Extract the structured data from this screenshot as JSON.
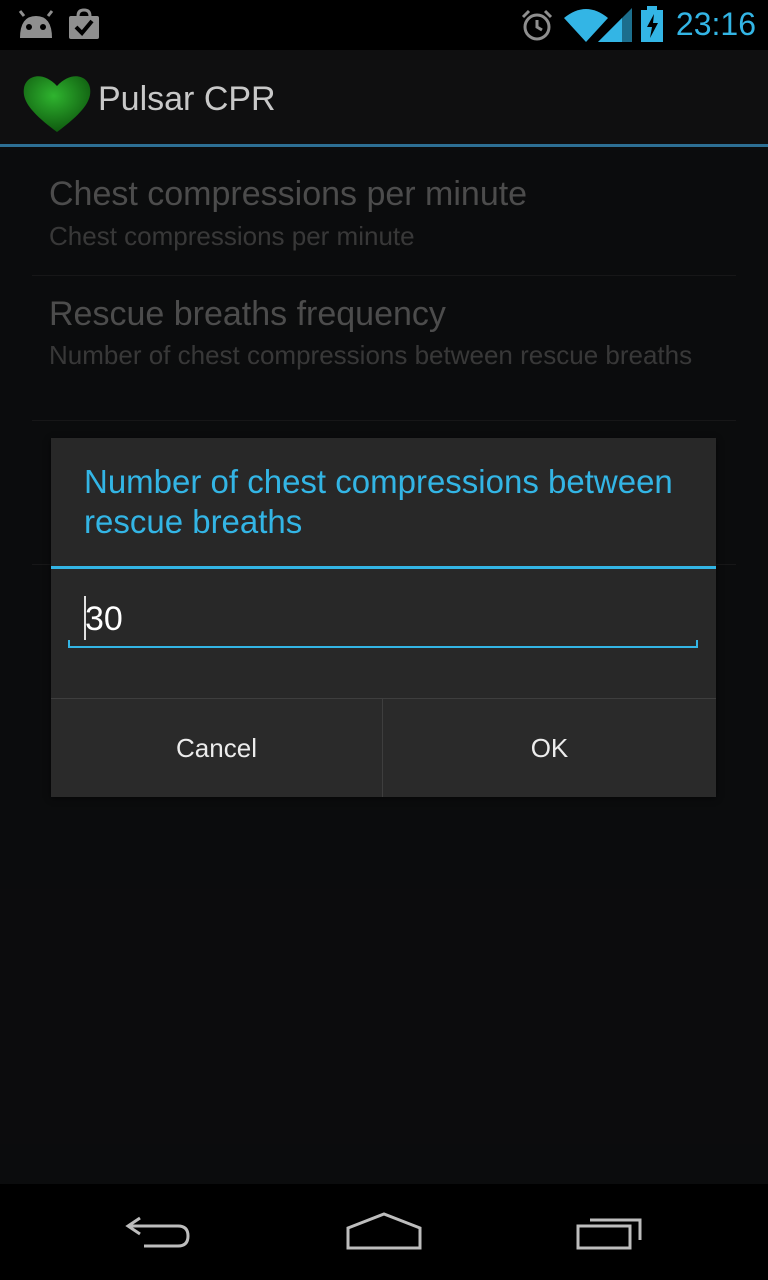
{
  "status_bar": {
    "time": "23:16",
    "icons": [
      "android-icon",
      "shopping-bag-check-icon",
      "alarm-icon",
      "wifi-icon",
      "signal-icon",
      "battery-charging-icon"
    ],
    "accent": "#33b5e5"
  },
  "action_bar": {
    "title": "Pulsar CPR",
    "logo": "heart-icon",
    "logo_color": "#1f8a1f"
  },
  "preferences": [
    {
      "title": "Chest compressions per minute",
      "summary": "Chest compressions per minute"
    },
    {
      "title": "Rescue breaths frequency",
      "summary": "Number of chest compressions between rescue breaths"
    }
  ],
  "dialog": {
    "title": "Number of chest compressions between rescue breaths",
    "input_value": "30",
    "cancel_label": "Cancel",
    "ok_label": "OK"
  },
  "nav_bar": {
    "buttons": [
      "back-icon",
      "home-icon",
      "recent-apps-icon"
    ]
  }
}
